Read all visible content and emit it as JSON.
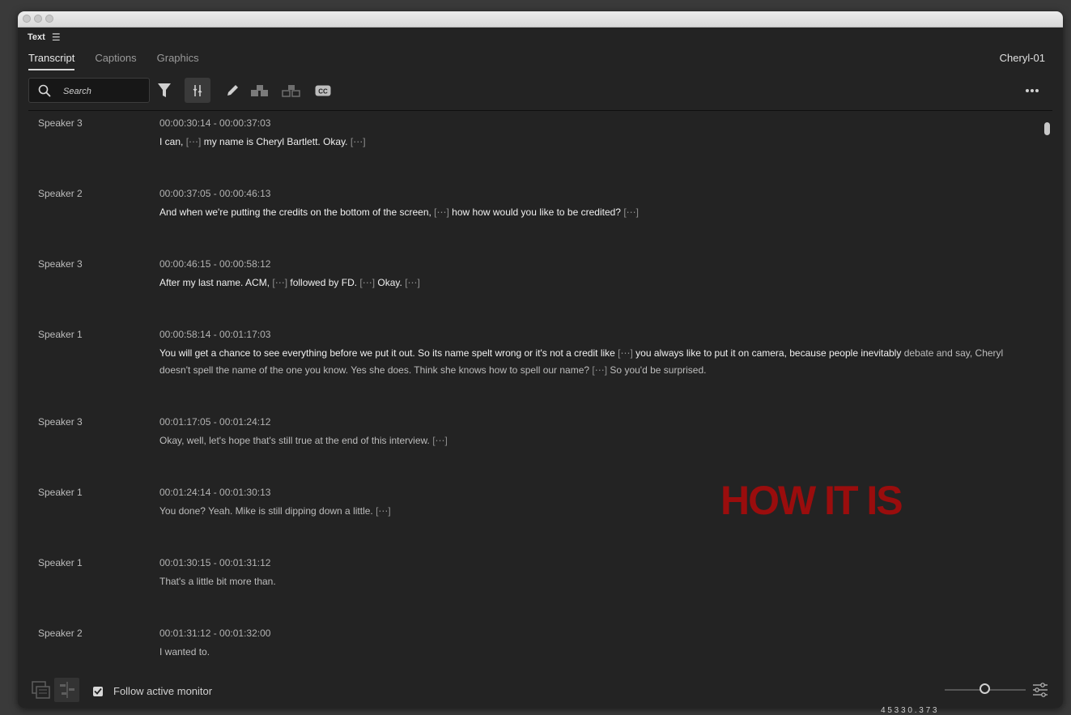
{
  "panel": {
    "title": "Text"
  },
  "tabs": [
    {
      "label": "Transcript",
      "active": true
    },
    {
      "label": "Captions",
      "active": false
    },
    {
      "label": "Graphics",
      "active": false
    }
  ],
  "clip_name": "Cheryl-01",
  "search": {
    "placeholder": "Search"
  },
  "toolbar_icons": [
    "filter-icon",
    "align-icon",
    "pencil-icon",
    "speaker-group-icon",
    "speaker-split-icon",
    "cc-icon",
    "more-icon"
  ],
  "watermark": "HOW IT IS",
  "entries": [
    {
      "speaker": "Speaker 3",
      "timecode": "00:00:30:14 - 00:00:37:03",
      "segments": [
        [
          "I can, ",
          "b"
        ],
        [
          "[⋯]",
          "g"
        ],
        [
          " my name is Cheryl Bartlett. Okay. ",
          "b"
        ],
        [
          "[⋯]",
          "g"
        ]
      ]
    },
    {
      "speaker": "Speaker 2",
      "timecode": "00:00:37:05 - 00:00:46:13",
      "segments": [
        [
          "And when we're putting the credits on the bottom of the screen, ",
          "b"
        ],
        [
          "[⋯]",
          "g"
        ],
        [
          " how how would you like to be credited? ",
          "b"
        ],
        [
          "[⋯]",
          "g"
        ]
      ]
    },
    {
      "speaker": "Speaker 3",
      "timecode": "00:00:46:15 - 00:00:58:12",
      "segments": [
        [
          "After my last name. ACM, ",
          "b"
        ],
        [
          "[⋯]",
          "g"
        ],
        [
          " followed by FD. ",
          "b"
        ],
        [
          "[⋯]",
          "g"
        ],
        [
          " Okay. ",
          "b"
        ],
        [
          "[⋯]",
          "g"
        ]
      ]
    },
    {
      "speaker": "Speaker 1",
      "timecode": "00:00:58:14 - 00:01:17:03",
      "segments": [
        [
          "You will get a chance to see everything before we put it out. So its name spelt wrong or it's not a credit like ",
          "b"
        ],
        [
          "[⋯]",
          "g"
        ],
        [
          " you always like to put it on camera, because people inevitably ",
          "b"
        ],
        [
          "debate and say, Cheryl doesn't spell the name of the one you know. Yes she does. Think she knows how to spell our name? ",
          "d"
        ],
        [
          "[⋯]",
          "g"
        ],
        [
          " So you'd be surprised.",
          "d"
        ]
      ]
    },
    {
      "speaker": "Speaker 3",
      "timecode": "00:01:17:05 - 00:01:24:12",
      "segments": [
        [
          "Okay, well, let's hope that's still true at the end of this interview. ",
          "d"
        ],
        [
          "[⋯]",
          "g"
        ]
      ]
    },
    {
      "speaker": "Speaker 1",
      "timecode": "00:01:24:14 - 00:01:30:13",
      "segments": [
        [
          "You done? Yeah. Mike is still dipping down a little. ",
          "d"
        ],
        [
          "[⋯]",
          "g"
        ]
      ]
    },
    {
      "speaker": "Speaker 1",
      "timecode": "00:01:30:15 - 00:01:31:12",
      "segments": [
        [
          "That's a little bit more than.",
          "d"
        ]
      ]
    },
    {
      "speaker": "Speaker 2",
      "timecode": "00:01:31:12 - 00:01:32:00",
      "segments": [
        [
          "I wanted to.",
          "d"
        ]
      ]
    }
  ],
  "footer": {
    "follow_label": "Follow active monitor",
    "follow_checked": true,
    "zoom_level": 0.5
  },
  "bottom_text": "4 5 3 3 0 . 3 7 3"
}
